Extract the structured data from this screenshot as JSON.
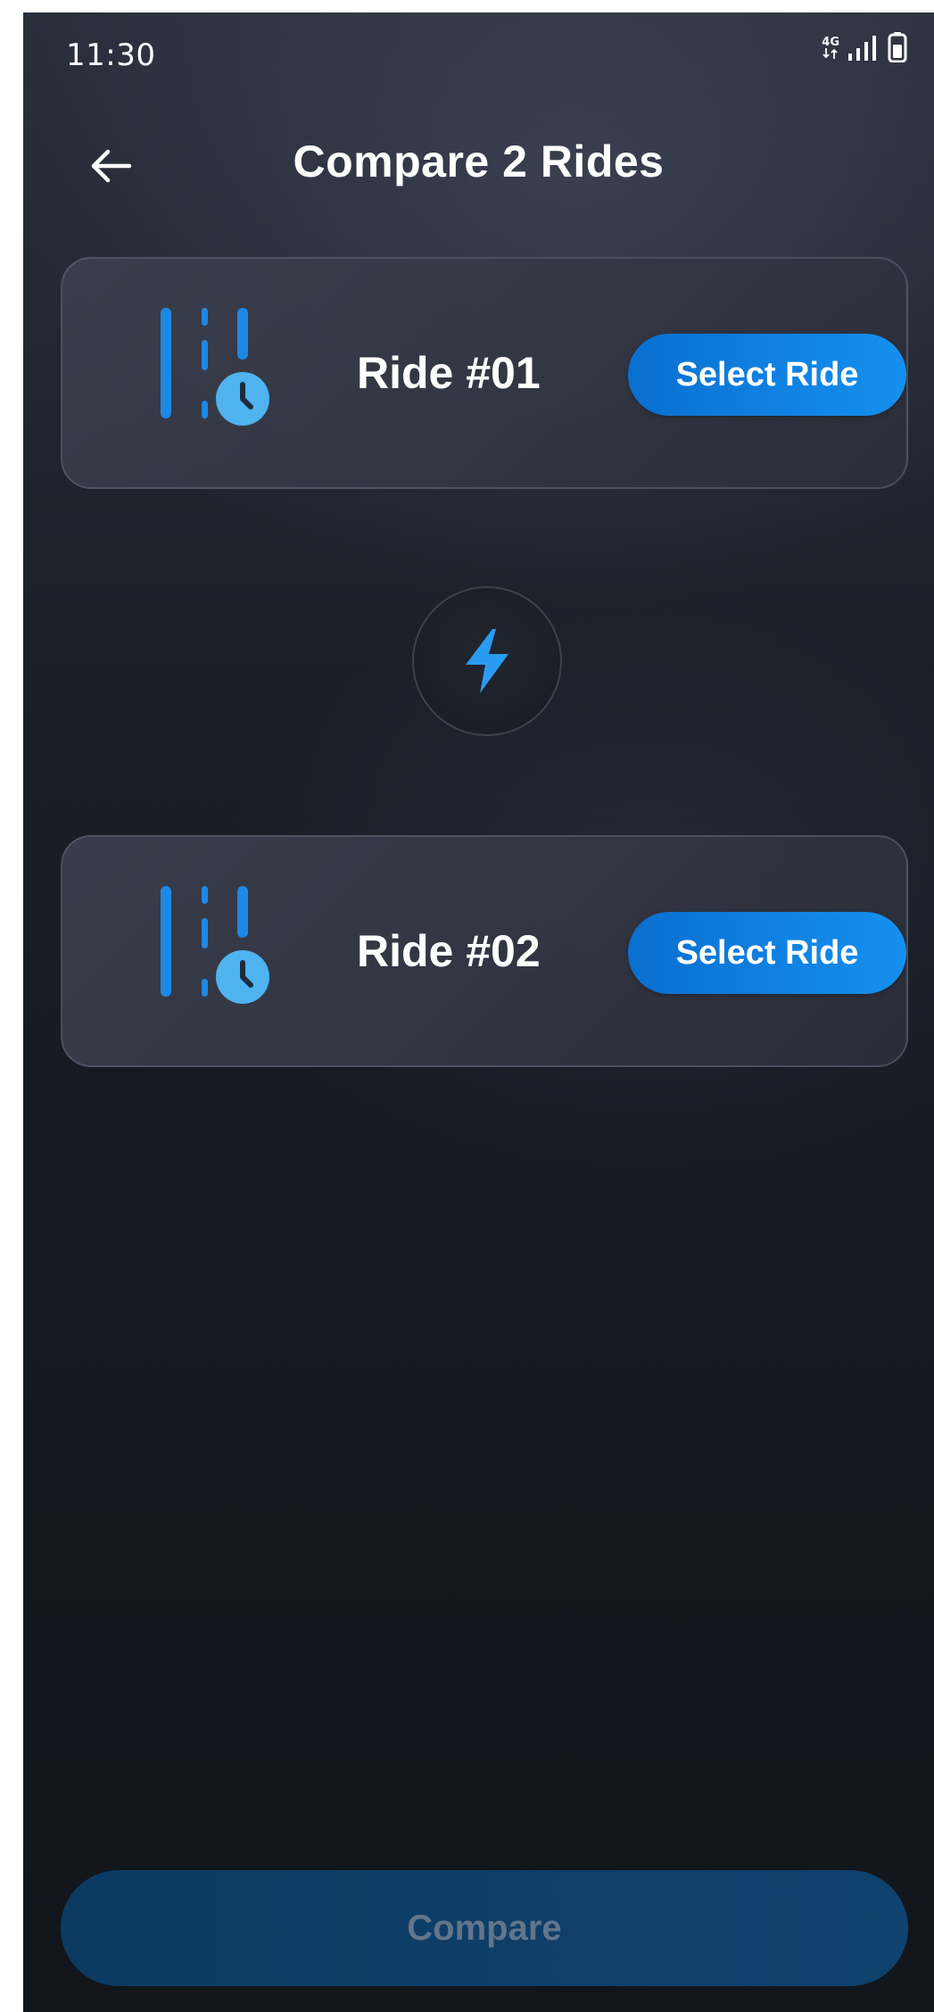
{
  "status_bar": {
    "time": "11:30",
    "network_type": "4G",
    "icons": [
      "network-4g-icon",
      "signal-icon",
      "battery-icon"
    ]
  },
  "header": {
    "title": "Compare 2 Rides",
    "back_icon": "arrow-left-icon"
  },
  "rides": [
    {
      "label": "Ride #01",
      "button_label": "Select Ride",
      "icon": "ride-history-icon"
    },
    {
      "label": "Ride #02",
      "button_label": "Select Ride",
      "icon": "ride-history-icon"
    }
  ],
  "divider_icon": "lightning-bolt-icon",
  "footer": {
    "compare_label": "Compare",
    "compare_enabled": false
  },
  "colors": {
    "accent": "#1590ee",
    "icon_blue": "#1e88e5",
    "clock_blue": "#4fb3f0",
    "background_dark": "#151820",
    "compare_disabled_bg": "#0f3d68",
    "compare_disabled_text": "#62758a"
  }
}
